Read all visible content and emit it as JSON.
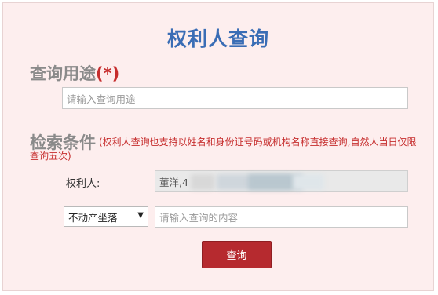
{
  "page": {
    "title": "权利人查询"
  },
  "purpose": {
    "title": "查询用途",
    "required_mark": "(*)",
    "placeholder": "请输入查询用途"
  },
  "conditions": {
    "title": "检索条件",
    "hint": "(权利人查询也支持以姓名和身份证号码或机构名称直接查询,自然人当日仅限查询五次)",
    "holder_label": "权利人:",
    "holder_value": "董洋,4",
    "search_type": {
      "selected": "不动产坐落",
      "caret": "▼"
    },
    "content_placeholder": "请输入查询的内容"
  },
  "actions": {
    "search_label": "查询"
  }
}
